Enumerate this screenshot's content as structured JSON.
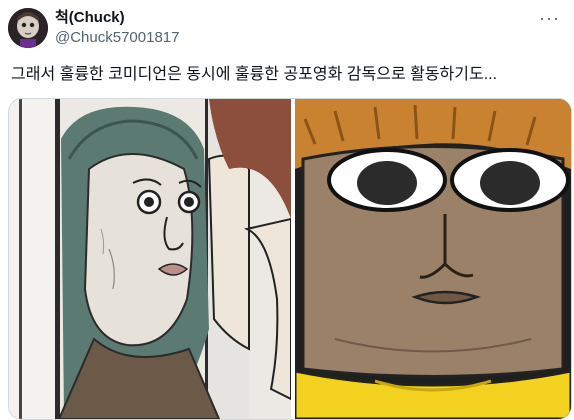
{
  "author": {
    "display_name": "척(Chuck)",
    "handle": "@Chuck57001817",
    "avatar_icon": "avatar-face-icon"
  },
  "more_menu": {
    "label": "···",
    "icon": "more-horizontal-icon"
  },
  "tweet": {
    "text": "그래서 훌륭한 코미디언은 동시에 훌륭한 공포영화 감독으로 활동하기도..."
  },
  "media": {
    "panels": [
      {
        "description_icon": "comic-panel-woman-peeking-icon"
      },
      {
        "description_icon": "comic-panel-wide-eyed-face-icon"
      }
    ]
  },
  "colors": {
    "text_primary": "#0f1419",
    "text_secondary": "#536471",
    "border": "#cfd9de",
    "background": "#ffffff"
  }
}
